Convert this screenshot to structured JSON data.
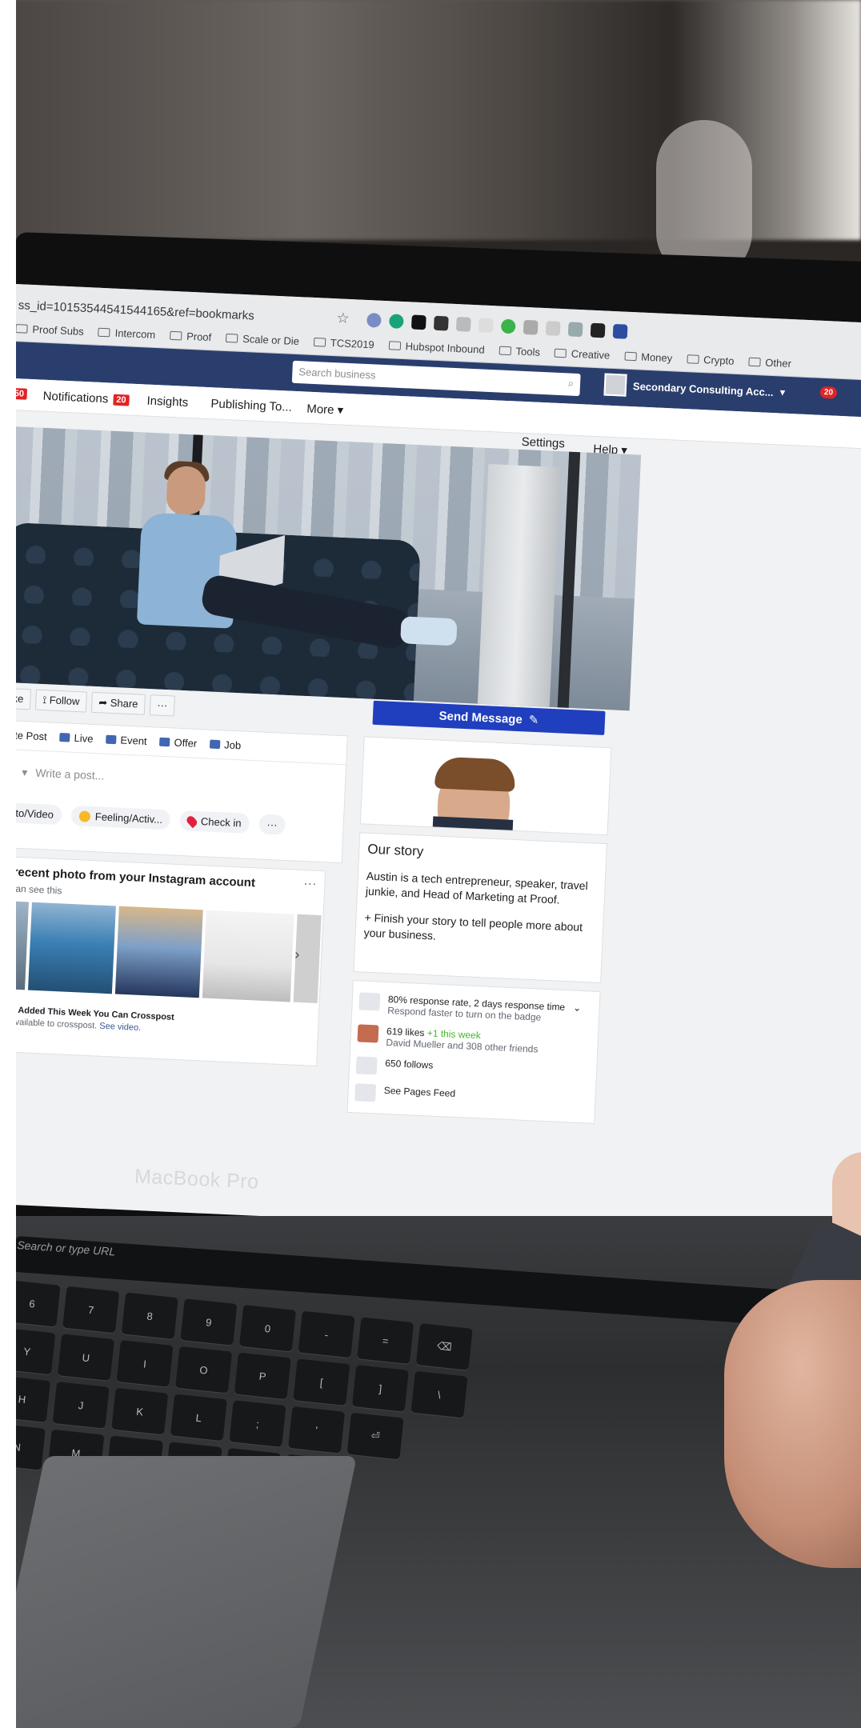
{
  "browser": {
    "url": "ss_id=10153544541544165&ref=bookmarks",
    "bookmarks": [
      "Proof Subs",
      "Intercom",
      "Proof",
      "Scale or Die",
      "TCS2019",
      "Hubspot Inbound",
      "Tools",
      "Creative",
      "Money",
      "Crypto",
      "Other"
    ]
  },
  "fb_bar": {
    "search_placeholder": "Search business",
    "account_name": "Secondary Consulting Acc...",
    "notif_count": "20"
  },
  "page_nav": {
    "left_badge": "50",
    "notifications_label": "Notifications",
    "notifications_count": "20",
    "insights_label": "Insights",
    "publishing_label": "Publishing To...",
    "more_label": "More ▾",
    "settings_label": "Settings",
    "help_label": "Help ▾"
  },
  "cover_actions": {
    "like": "Like",
    "follow": "Follow",
    "share": "Share",
    "more": "···"
  },
  "send_message": "Send Message",
  "composer": {
    "tabs": [
      "reate Post",
      "Live",
      "Event",
      "Offer",
      "Job"
    ],
    "write_placeholder": "Write a post...",
    "options": {
      "photo": "hoto/Video",
      "feeling": "Feeling/Activ...",
      "checkin": "Check in",
      "more": "···"
    }
  },
  "instagram": {
    "title": "e a recent photo from your Instagram account",
    "subtitle": "you can see this",
    "more": "···",
    "crosspost_title": "Videos Added This Week You Can Crosspost",
    "crosspost_sub": "video available to crosspost.",
    "crosspost_link": "See video."
  },
  "story": {
    "title": "Our story",
    "body": "Austin is a tech entrepreneur, speaker, travel junkie, and Head of Marketing at Proof.",
    "finish": "+ Finish your story to tell people more about your business."
  },
  "stats": {
    "response_rate": "80% response rate, 2 days response time",
    "response_sub": "Respond faster to turn on the badge",
    "likes": "619 likes",
    "likes_week": "+1 this week",
    "likes_sub": "David Mueller and 308 other friends",
    "follows": "650 follows",
    "pages_feed": "See Pages Feed"
  },
  "hardware": {
    "macbook_label": "MacBook Pro",
    "touchbar_text": "Search or type URL"
  },
  "colors": {
    "fb_blue_bar": "#2a3e6e",
    "send_message": "#1f3fbf",
    "badge_red": "#e02424",
    "likes_green": "#42b72a"
  }
}
